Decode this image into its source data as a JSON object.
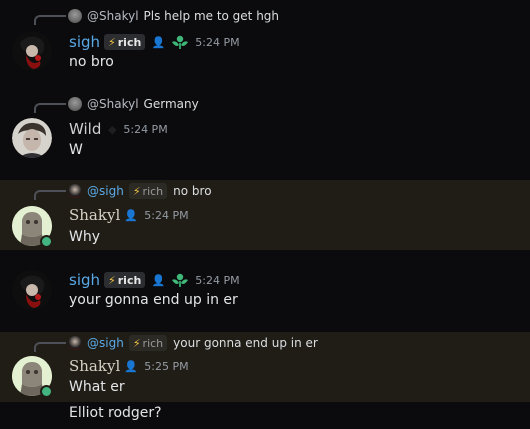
{
  "messages": [
    {
      "reply": {
        "name": "@Shakyl",
        "text": "Pls help me to get hgh"
      },
      "author": "sigh",
      "tag": "rich",
      "time": "5:24 PM",
      "lines": [
        "no bro"
      ]
    },
    {
      "reply": {
        "name": "@Shakyl",
        "text": "Germany"
      },
      "author": "Wild",
      "time": "5:24 PM",
      "lines": [
        "W"
      ]
    },
    {
      "reply": {
        "name": "@sigh",
        "tag": "rich",
        "text": "no bro"
      },
      "author": "Shakyl",
      "time": "5:24 PM",
      "lines": [
        "Why"
      ]
    },
    {
      "author": "sigh",
      "tag": "rich",
      "time": "5:24 PM",
      "lines": [
        "your gonna end up in er"
      ]
    },
    {
      "reply": {
        "name": "@sigh",
        "tag": "rich",
        "text": "your gonna end up in er"
      },
      "author": "Shakyl",
      "time": "5:25 PM",
      "lines": [
        "What er",
        "Elliot rodger?"
      ]
    }
  ],
  "icons": {
    "tag_icon": "lightning-bolt-icon",
    "role_icon": "person-icon",
    "badge_icon": "green-leaf-badge-icon"
  },
  "colors": {
    "background": "#0b0b0d",
    "highlight": "#201d16",
    "sigh_name": "#5aa9e6",
    "tag_bolt": "#f5c542"
  }
}
